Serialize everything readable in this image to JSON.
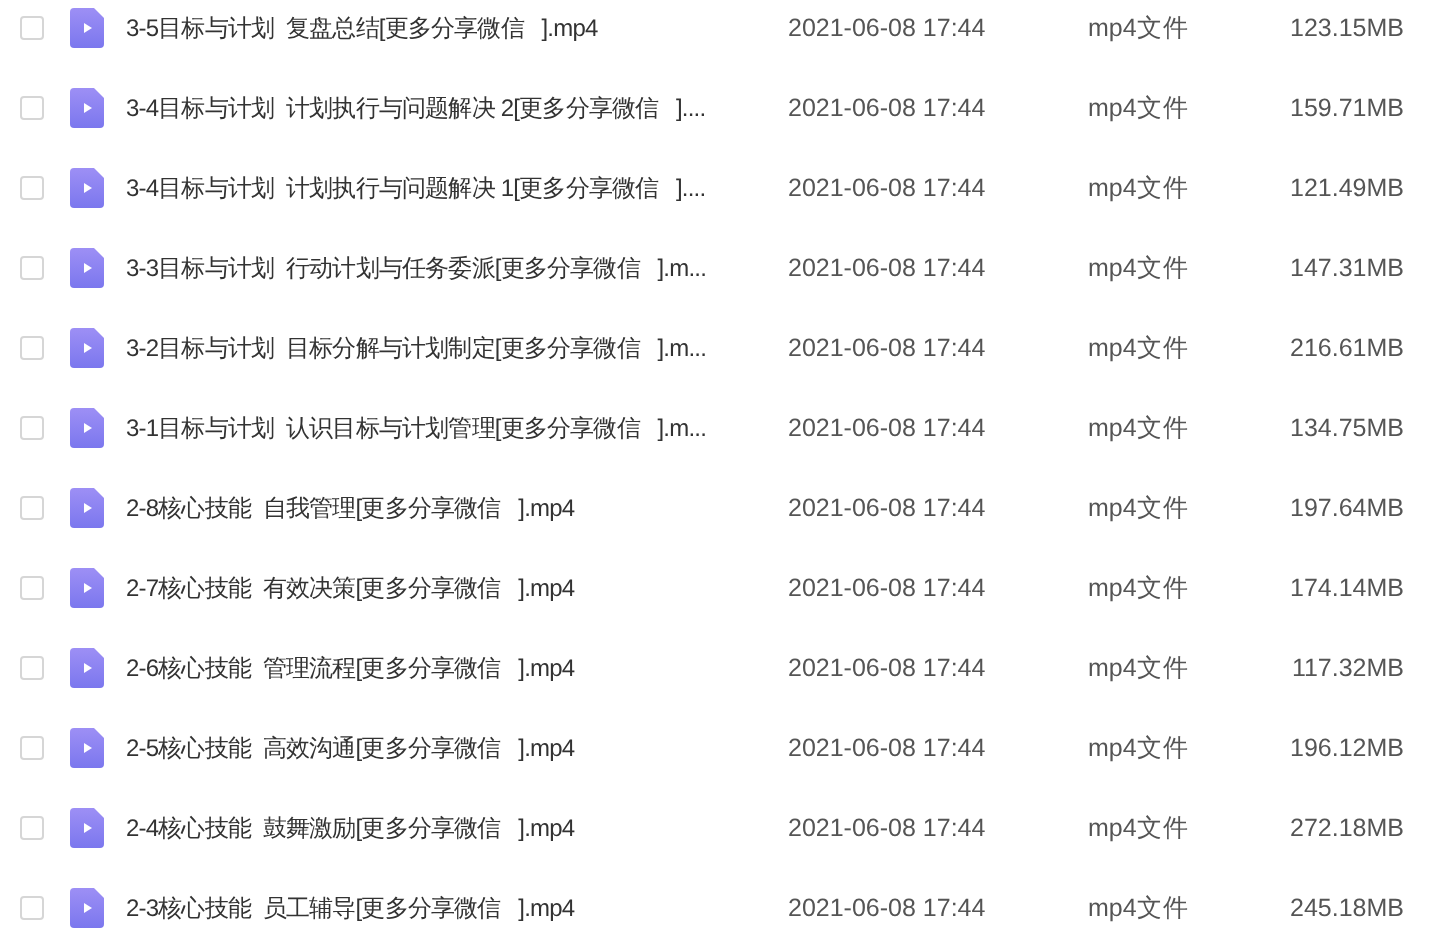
{
  "files": [
    {
      "name": "3-5目标与计划  复盘总结[更多分享微信   ].mp4",
      "modified": "2021-06-08 17:44",
      "type": "mp4文件",
      "size": "123.15MB",
      "checked": false
    },
    {
      "name": "3-4目标与计划  计划执行与问题解决 2[更多分享微信   ]....",
      "modified": "2021-06-08 17:44",
      "type": "mp4文件",
      "size": "159.71MB",
      "checked": false
    },
    {
      "name": "3-4目标与计划  计划执行与问题解决 1[更多分享微信   ]....",
      "modified": "2021-06-08 17:44",
      "type": "mp4文件",
      "size": "121.49MB",
      "checked": false
    },
    {
      "name": "3-3目标与计划  行动计划与任务委派[更多分享微信   ].m...",
      "modified": "2021-06-08 17:44",
      "type": "mp4文件",
      "size": "147.31MB",
      "checked": false
    },
    {
      "name": "3-2目标与计划  目标分解与计划制定[更多分享微信   ].m...",
      "modified": "2021-06-08 17:44",
      "type": "mp4文件",
      "size": "216.61MB",
      "checked": false
    },
    {
      "name": "3-1目标与计划  认识目标与计划管理[更多分享微信   ].m...",
      "modified": "2021-06-08 17:44",
      "type": "mp4文件",
      "size": "134.75MB",
      "checked": false
    },
    {
      "name": "2-8核心技能  自我管理[更多分享微信   ].mp4",
      "modified": "2021-06-08 17:44",
      "type": "mp4文件",
      "size": "197.64MB",
      "checked": false
    },
    {
      "name": "2-7核心技能  有效决策[更多分享微信   ].mp4",
      "modified": "2021-06-08 17:44",
      "type": "mp4文件",
      "size": "174.14MB",
      "checked": false
    },
    {
      "name": "2-6核心技能  管理流程[更多分享微信   ].mp4",
      "modified": "2021-06-08 17:44",
      "type": "mp4文件",
      "size": "117.32MB",
      "checked": false
    },
    {
      "name": "2-5核心技能  高效沟通[更多分享微信   ].mp4",
      "modified": "2021-06-08 17:44",
      "type": "mp4文件",
      "size": "196.12MB",
      "checked": false
    },
    {
      "name": "2-4核心技能  鼓舞激励[更多分享微信   ].mp4",
      "modified": "2021-06-08 17:44",
      "type": "mp4文件",
      "size": "272.18MB",
      "checked": false
    },
    {
      "name": "2-3核心技能  员工辅导[更多分享微信   ].mp4",
      "modified": "2021-06-08 17:44",
      "type": "mp4文件",
      "size": "245.18MB",
      "checked": false
    }
  ]
}
